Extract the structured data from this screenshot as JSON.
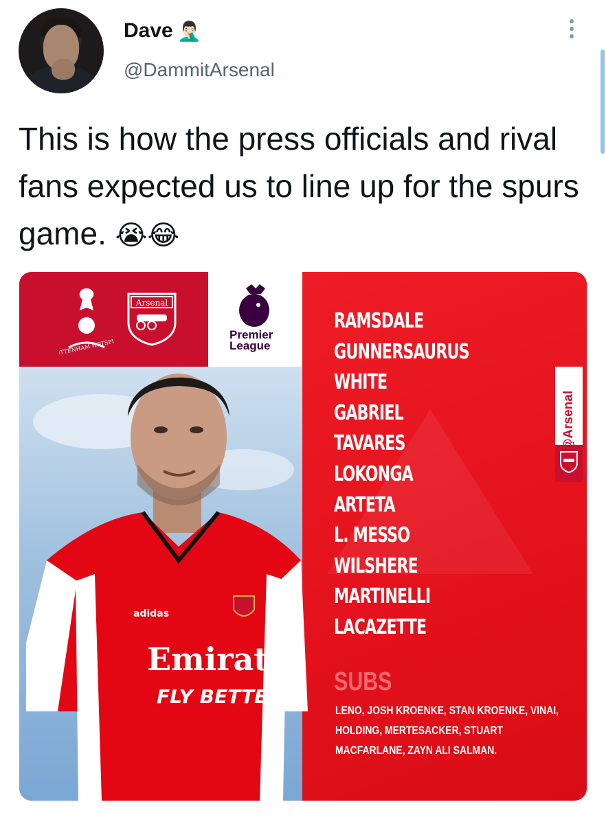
{
  "tweet": {
    "display_name": "Dave",
    "name_emoji": "🤦🏻‍♂️",
    "handle": "@DammitArsenal",
    "text": "This is how the press officials and rival fans expected us to line up for the spurs game.",
    "text_emojis": "😭😂"
  },
  "graphic": {
    "spurs_logo_text": "TOTTENHAM HOTSPUR",
    "arsenal_crest_text": "Arsenal",
    "premier_league": "Premier League",
    "side_tag": "@Arsenal",
    "shirt_sponsor": "Emirates",
    "shirt_slogan": "FLY BETTER",
    "shirt_brand": "adidas",
    "lineup": [
      "RAMSDALE",
      "GUNNERSAURUS",
      "WHITE",
      "GABRIEL",
      "TAVARES",
      "LOKONGA",
      "ARTETA",
      "L. MESSO",
      "WILSHERE",
      "MARTINELLI",
      "LACAZETTE"
    ],
    "subs_title": "SUBS",
    "subs_text": "LENO, JOSH KROENKE, STAN KROENKE, VINAI, HOLDING, MERTESACKER, STUART MACFARLANE, ZAYN ALI SALMAN."
  },
  "colors": {
    "arsenal_red": "#ed1c24",
    "dark_red": "#c8102e",
    "pl_purple": "#38003c",
    "handle_gray": "#536471"
  }
}
